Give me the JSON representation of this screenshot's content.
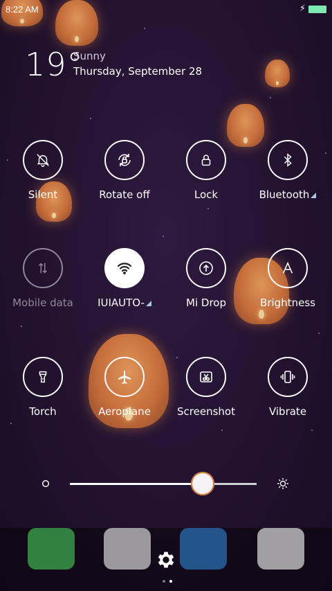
{
  "status": {
    "time": "8:22 AM"
  },
  "weather": {
    "temperature": "19°",
    "condition": "Sunny",
    "date": "Thursday, September 28"
  },
  "toggles": [
    {
      "label": "Silent"
    },
    {
      "label": "Rotate off"
    },
    {
      "label": "Lock"
    },
    {
      "label": "Bluetooth"
    },
    {
      "label": "Mobile data"
    },
    {
      "label": "IUIAUTO-"
    },
    {
      "label": "Mi Drop"
    },
    {
      "label": "Brightness"
    },
    {
      "label": "Torch"
    },
    {
      "label": "Aeroplane"
    },
    {
      "label": "Screenshot"
    },
    {
      "label": "Vibrate"
    }
  ],
  "brightness": {
    "level": 0.71
  },
  "colors": {
    "accent_orange": "#d7773c",
    "battery_green": "#7fe8b0"
  }
}
